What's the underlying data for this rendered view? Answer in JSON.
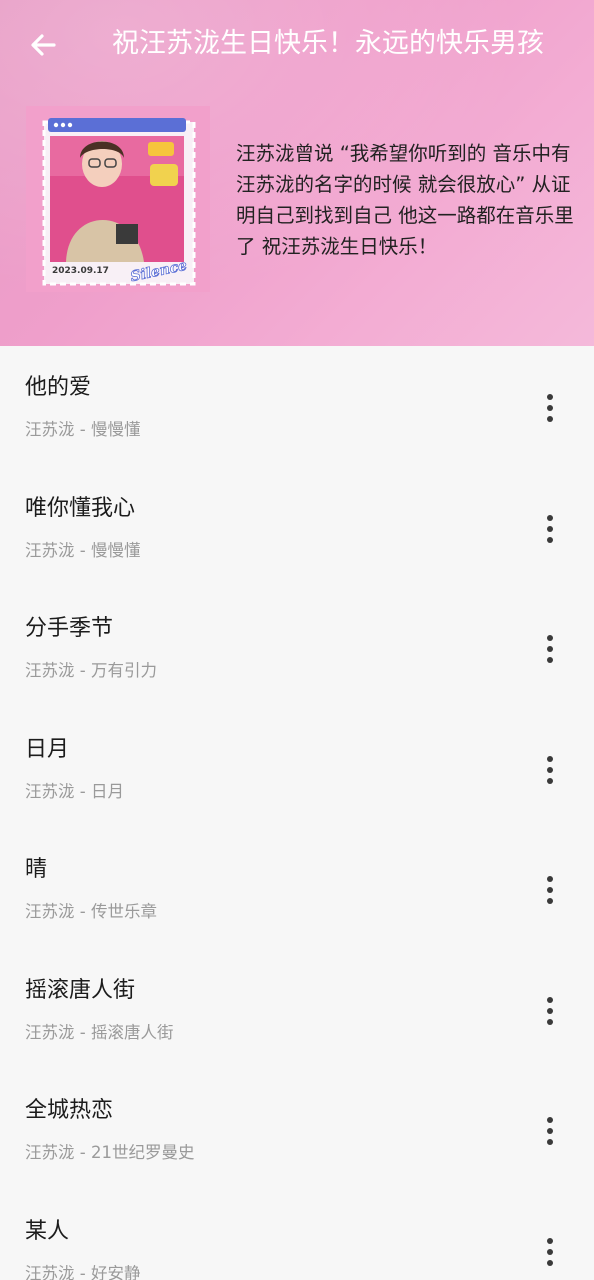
{
  "header": {
    "title": "祝汪苏泷生日快乐！永远的快乐男孩",
    "back_icon": "arrow-left-icon",
    "description": "汪苏泷曾说 “我希望你听到的 音乐中有汪苏泷的名字的时候 就会很放心” 从证明自己到找到自己 他这一路都在音乐里了 祝汪苏泷生日快乐！",
    "cover": {
      "date": "2023.09.17",
      "tag": "Silence"
    },
    "colors": {
      "gradient_start": "#e79ac4",
      "gradient_end": "#f4b9da"
    }
  },
  "songs": [
    {
      "title": "他的爱",
      "subtitle": "汪苏泷 - 慢慢懂"
    },
    {
      "title": "唯你懂我心",
      "subtitle": "汪苏泷 - 慢慢懂"
    },
    {
      "title": "分手季节",
      "subtitle": "汪苏泷 - 万有引力"
    },
    {
      "title": "日月",
      "subtitle": "汪苏泷 - 日月"
    },
    {
      "title": "晴",
      "subtitle": "汪苏泷 - 传世乐章"
    },
    {
      "title": "摇滚唐人街",
      "subtitle": "汪苏泷 - 摇滚唐人街"
    },
    {
      "title": "全城热恋",
      "subtitle": "汪苏泷 - 21世纪罗曼史"
    },
    {
      "title": "某人",
      "subtitle": "汪苏泷 - 好安静"
    }
  ],
  "row_icon": "more-vertical-icon"
}
